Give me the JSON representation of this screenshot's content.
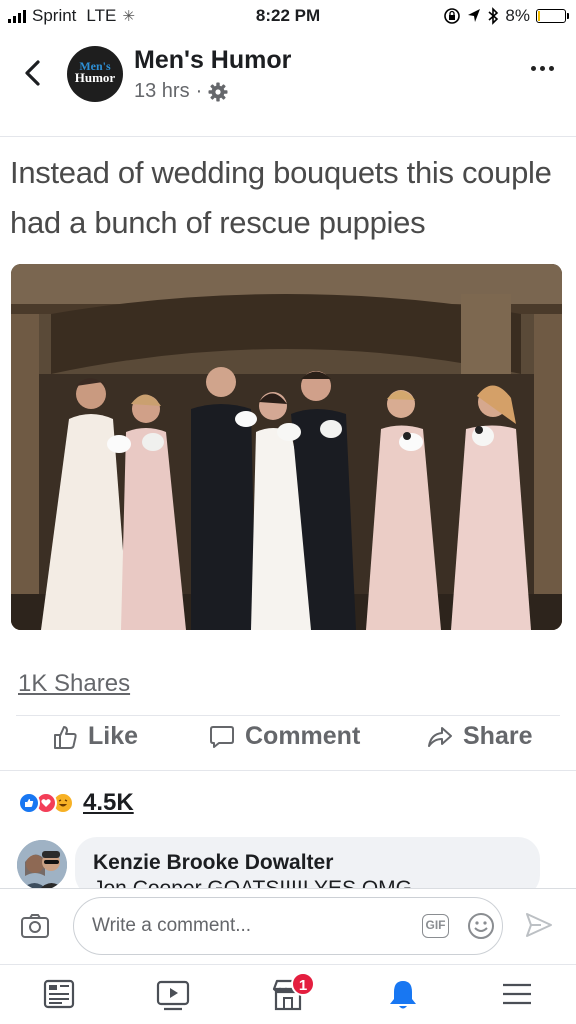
{
  "status_bar": {
    "carrier": "Sprint",
    "network": "LTE",
    "time": "8:22 PM",
    "battery": "8%",
    "battery_level": 0.08
  },
  "post_header": {
    "page_name": "Men's Humor",
    "timestamp": "13 hrs",
    "separator": "·",
    "avatar_text_line1": "Men's",
    "avatar_text_line2": "Humor"
  },
  "post": {
    "caption": "Instead of wedding bouquets this couple had a bunch of rescue puppies",
    "shares": "1K Shares"
  },
  "actions": {
    "like": "Like",
    "comment": "Comment",
    "share": "Share"
  },
  "reactions": {
    "count": "4.5K",
    "types": [
      "like",
      "love",
      "haha"
    ]
  },
  "comment_preview": {
    "author": "Kenzie Brooke Dowalter",
    "text": "Jon Cooper      GOATSIIIII YES OMG"
  },
  "comment_bar": {
    "placeholder": "Write a comment...",
    "gif_label": "GIF"
  },
  "bottom_nav": {
    "marketplace_badge": "1"
  },
  "colors": {
    "facebook_blue": "#1877f2",
    "badge_red": "#e41e3f",
    "love_red": "#f33e58",
    "haha_yellow": "#f7b125"
  }
}
